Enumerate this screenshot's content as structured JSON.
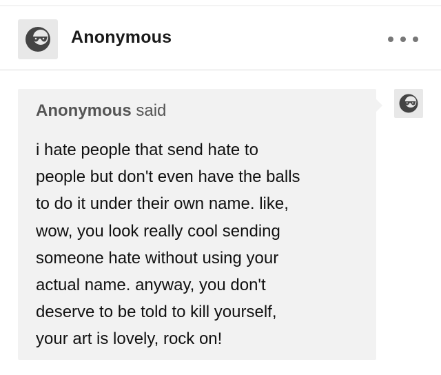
{
  "header": {
    "blog_name": "Anonymous",
    "avatar_icon": "anonymous-sunglasses-icon",
    "more_icon": "more-horizontal-icon"
  },
  "ask": {
    "asker_name": "Anonymous",
    "said_label": "said",
    "avatar_icon": "anonymous-sunglasses-icon",
    "text": "i hate people that send hate to\npeople but don't even have the balls\nto do it under their own name. like,\nwow, you look really cool sending\nsomeone hate without using your\nactual name. anyway, you don't\ndeserve to be told to kill yourself,\nyour art is lovely, rock on!"
  },
  "colors": {
    "ask_background": "#f2f2f2",
    "avatar_background": "#e8e8e8",
    "avatar_face": "#444444"
  }
}
